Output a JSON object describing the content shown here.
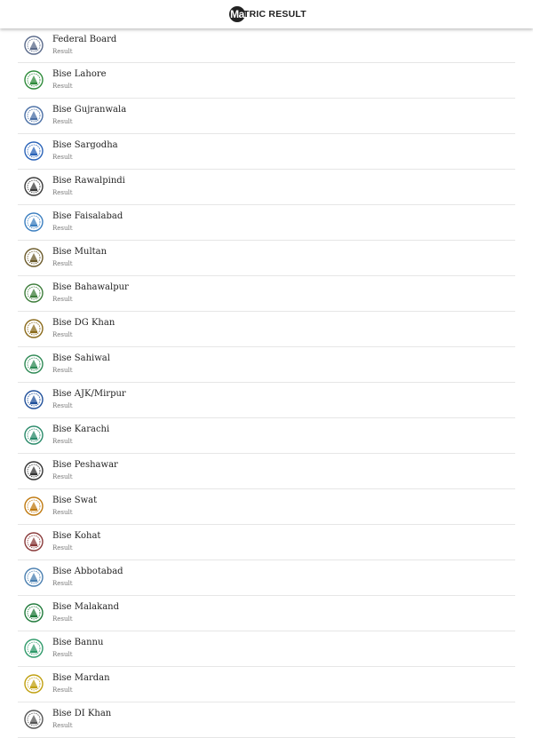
{
  "app": {
    "logo_letter": "Ma",
    "title": "TRIC RESULT"
  },
  "boards": [
    {
      "name": "Federal Board",
      "sub": "Result",
      "icon": "federal-board-seal-icon",
      "color": "#5a6a8a"
    },
    {
      "name": "Bise Lahore",
      "sub": "Result",
      "icon": "bise-lahore-seal-icon",
      "color": "#2e8b3a"
    },
    {
      "name": "Bise Gujranwala",
      "sub": "Result",
      "icon": "bise-gujranwala-seal-icon",
      "color": "#4a6fa5"
    },
    {
      "name": "Bise Sargodha",
      "sub": "Result",
      "icon": "bise-sargodha-seal-icon",
      "color": "#2a63b8"
    },
    {
      "name": "Bise Rawalpindi",
      "sub": "Result",
      "icon": "bise-rawalpindi-seal-icon",
      "color": "#3a3a3a"
    },
    {
      "name": "Bise Faisalabad",
      "sub": "Result",
      "icon": "bise-faisalabad-seal-icon",
      "color": "#3c7fc0"
    },
    {
      "name": "Bise Multan",
      "sub": "Result",
      "icon": "bise-multan-seal-icon",
      "color": "#6b5a2a"
    },
    {
      "name": "Bise Bahawalpur",
      "sub": "Result",
      "icon": "bise-bahawalpur-seal-icon",
      "color": "#3d7d3a"
    },
    {
      "name": "Bise DG Khan",
      "sub": "Result",
      "icon": "bise-dg-khan-seal-icon",
      "color": "#8a6a1a"
    },
    {
      "name": "Bise Sahiwal",
      "sub": "Result",
      "icon": "bise-sahiwal-seal-icon",
      "color": "#2f8a55"
    },
    {
      "name": "Bise AJK/Mirpur",
      "sub": "Result",
      "icon": "bise-ajk-mirpur-seal-icon",
      "color": "#1f4f9a"
    },
    {
      "name": "Bise Karachi",
      "sub": "Result",
      "icon": "bise-karachi-seal-icon",
      "color": "#2a8a6a"
    },
    {
      "name": "Bise Peshawar",
      "sub": "Result",
      "icon": "bise-peshawar-seal-icon",
      "color": "#333333"
    },
    {
      "name": "Bise Swat",
      "sub": "Result",
      "icon": "bise-swat-seal-icon",
      "color": "#c07a10"
    },
    {
      "name": "Bise Kohat",
      "sub": "Result",
      "icon": "bise-kohat-seal-icon",
      "color": "#8a3a3a"
    },
    {
      "name": "Bise Abbotabad",
      "sub": "Result",
      "icon": "bise-abbotabad-seal-icon",
      "color": "#4a7fb0"
    },
    {
      "name": "Bise Malakand",
      "sub": "Result",
      "icon": "bise-malakand-seal-icon",
      "color": "#1f7a3a"
    },
    {
      "name": "Bise Bannu",
      "sub": "Result",
      "icon": "bise-bannu-seal-icon",
      "color": "#2f9a6a"
    },
    {
      "name": "Bise Mardan",
      "sub": "Result",
      "icon": "bise-mardan-seal-icon",
      "color": "#c0a010"
    },
    {
      "name": "Bise DI Khan",
      "sub": "Result",
      "icon": "bise-di-khan-seal-icon",
      "color": "#555555"
    }
  ]
}
